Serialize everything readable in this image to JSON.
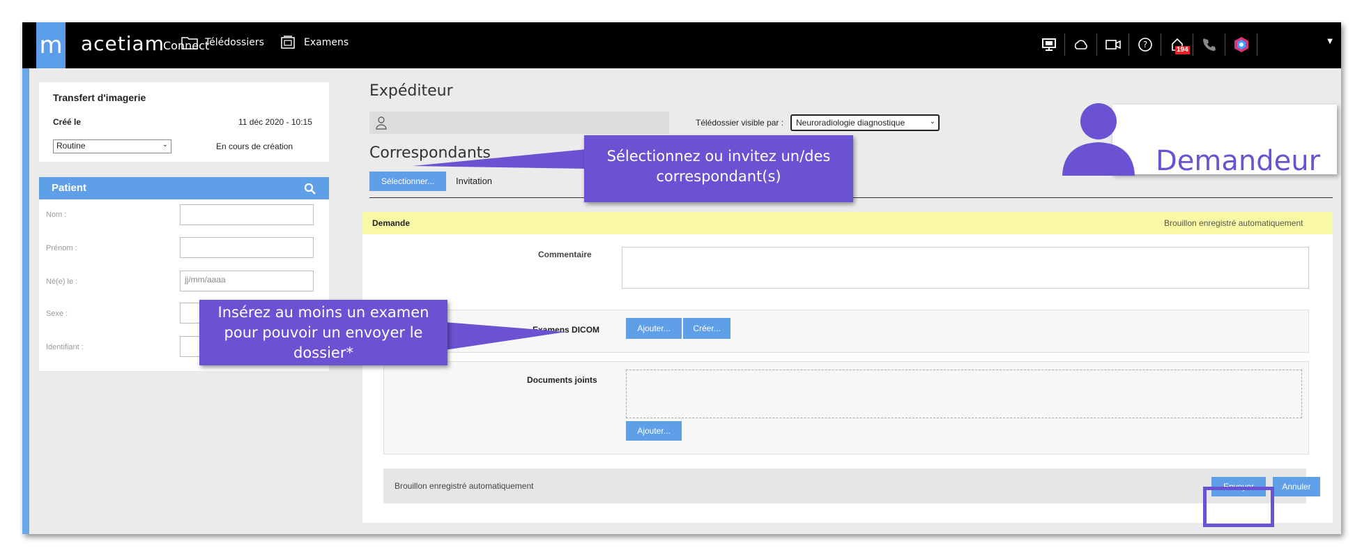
{
  "topbar": {
    "brand": "acetiam",
    "brand_sub": "Connect",
    "nav": [
      {
        "label": "Télédossiers",
        "icon": "folder-icon"
      },
      {
        "label": "Examens",
        "icon": "image-folder-icon"
      }
    ],
    "notification_count": "194",
    "icons": [
      "monitor-icon",
      "cloud-icon",
      "video-icon",
      "help-icon",
      "notifications-icon",
      "phone-icon",
      "app-hexagon-icon"
    ]
  },
  "transfer": {
    "title": "Transfert d'imagerie",
    "created_label": "Créé le",
    "created_value": "11 déc 2020 - 10:15",
    "priority": "Routine",
    "status": "En cours de création"
  },
  "patient": {
    "title": "Patient",
    "fields": [
      {
        "label": "Nom :",
        "value": "",
        "placeholder": ""
      },
      {
        "label": "Prénom :",
        "value": "",
        "placeholder": ""
      },
      {
        "label": "Né(e) le :",
        "value": "",
        "placeholder": "jj/mm/aaaa"
      },
      {
        "label": "Sexe :",
        "value": "",
        "placeholder": ""
      },
      {
        "label": "Identifiant :",
        "value": "",
        "placeholder": ""
      }
    ]
  },
  "sender": {
    "title": "Expéditeur",
    "visible_label": "Télédossier visible par :",
    "visible_value": "Neuroradiologie diagnostique"
  },
  "correspondents": {
    "title": "Correspondants",
    "tabs": [
      "Sélectionner...",
      "Invitation"
    ]
  },
  "request": {
    "title": "Demande",
    "autosave": "Brouillon enregistré automatiquement",
    "comment_label": "Commentaire",
    "dicom_label": "Examens DICOM",
    "add_label": "Ajouter...",
    "create_label": "Créer...",
    "docs_label": "Documents joints",
    "docs_add_label": "Ajouter...",
    "footer_status": "Brouillon enregistré automatiquement",
    "send_label": "Envoyer",
    "cancel_label": "Annuler"
  },
  "annotations": {
    "correspondents_callout": "Sélectionnez  ou invitez un/des correspondant(s)",
    "exam_callout": "Insérez au moins un examen pour pouvoir un envoyer le dossier*",
    "requester_label": "Demandeur"
  },
  "colors": {
    "accent": "#5f9fe8",
    "callout": "#6a52d2",
    "topbar": "#000000",
    "draft_bar": "#fafaa6"
  }
}
